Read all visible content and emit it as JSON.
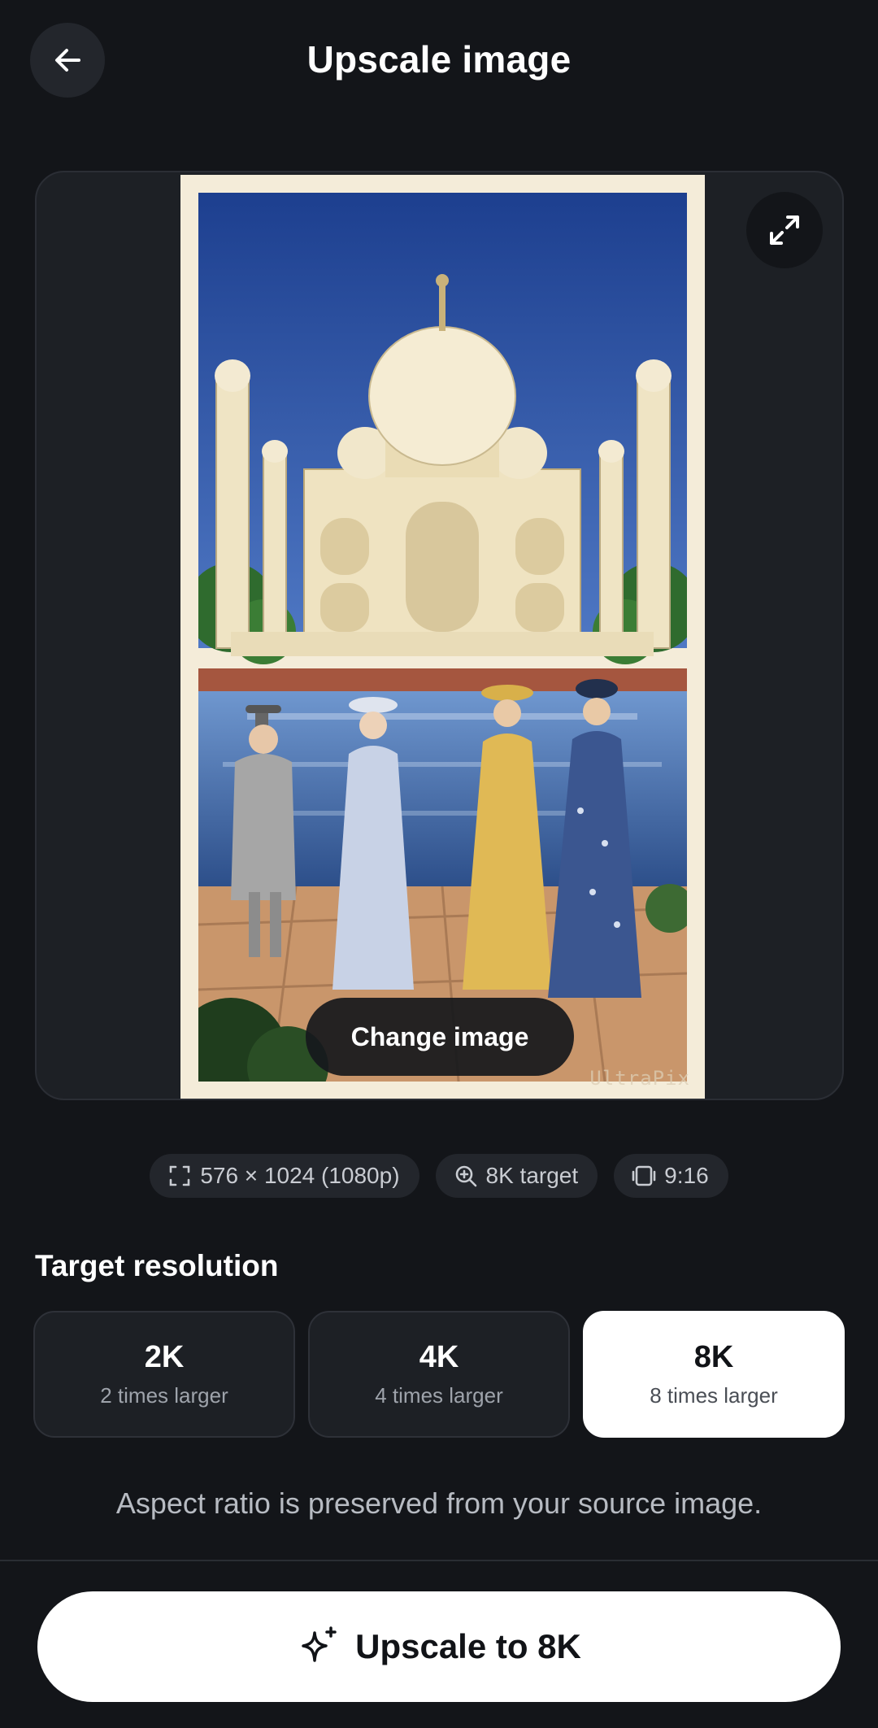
{
  "header": {
    "title": "Upscale image",
    "back_icon": "arrow-left-icon"
  },
  "preview": {
    "watermark": "UltraPix",
    "expand_icon": "expand-icon",
    "change_label": "Change image"
  },
  "chips": [
    {
      "icon": "frame-icon",
      "label": "576 × 1024 (1080p)"
    },
    {
      "icon": "zoom-in-icon",
      "label": "8K target"
    },
    {
      "icon": "aspect-ratio-icon",
      "label": "9:16"
    }
  ],
  "resolution": {
    "title": "Target resolution",
    "options": [
      {
        "value": "2K",
        "desc": "2 times larger"
      },
      {
        "value": "4K",
        "desc": "4 times larger"
      },
      {
        "value": "8K",
        "desc": "8 times larger"
      }
    ],
    "selected": "8K"
  },
  "note": "Aspect ratio is preserved from your source image.",
  "cta": {
    "icon": "sparkle-icon",
    "label": "Upscale to 8K"
  },
  "colors": {
    "background": "#131519",
    "surface": "#1d2025",
    "selected": "#ffffff"
  }
}
